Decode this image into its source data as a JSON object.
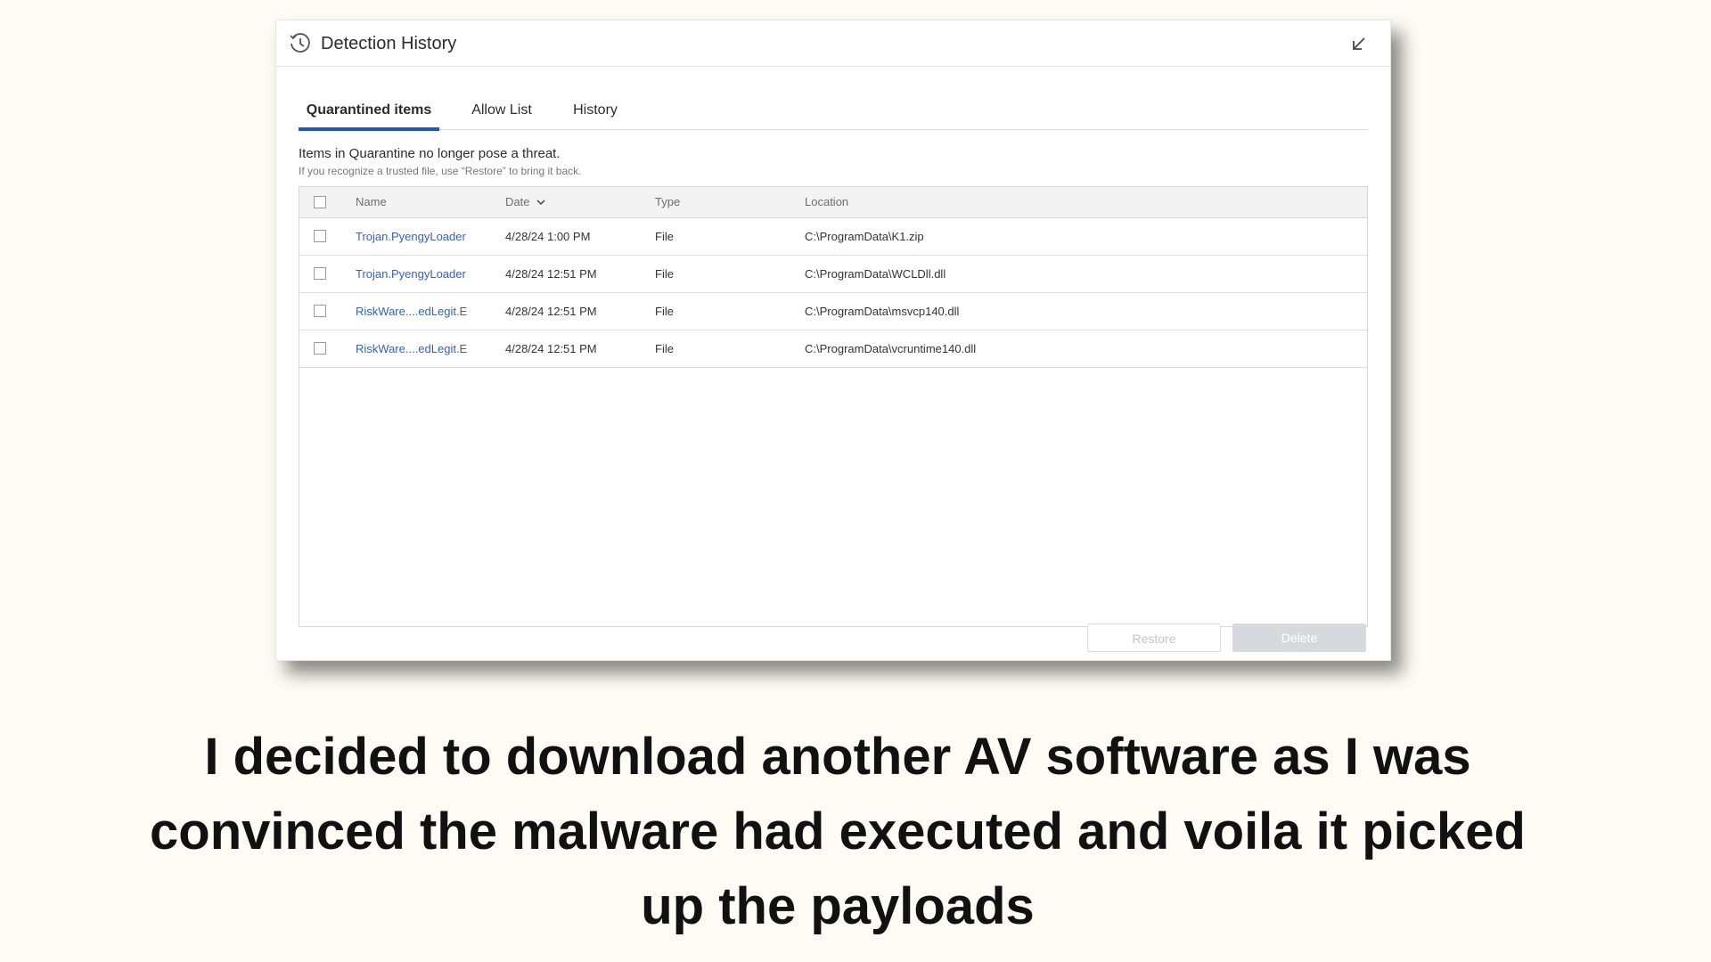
{
  "dialog": {
    "title": "Detection History",
    "title_icon": "clock-history-icon",
    "collapse_icon": "arrow-down-left-icon",
    "tabs": [
      {
        "label": "Quarantined items",
        "active": true
      },
      {
        "label": "Allow List",
        "active": false
      },
      {
        "label": "History",
        "active": false
      }
    ],
    "info": {
      "main": "Items in Quarantine no longer pose a threat.",
      "sub": "If you recognize a trusted file, use “Restore” to bring it back."
    },
    "table": {
      "columns": {
        "name": "Name",
        "date": "Date",
        "type": "Type",
        "location": "Location"
      },
      "rows": [
        {
          "name": "Trojan.PyengyLoader",
          "date": "4/28/24 1:00 PM",
          "type": "File",
          "location": "C:\\ProgramData\\K1.zip"
        },
        {
          "name": "Trojan.PyengyLoader",
          "date": "4/28/24 12:51 PM",
          "type": "File",
          "location": "C:\\ProgramData\\WCLDll.dll"
        },
        {
          "name": "RiskWare....edLegit.E",
          "date": "4/28/24 12:51 PM",
          "type": "File",
          "location": "C:\\ProgramData\\msvcp140.dll"
        },
        {
          "name": "RiskWare....edLegit.E",
          "date": "4/28/24 12:51 PM",
          "type": "File",
          "location": "C:\\ProgramData\\vcruntime140.dll"
        }
      ]
    },
    "buttons": {
      "restore": "Restore",
      "delete": "Delete"
    }
  },
  "caption": {
    "line1": "I decided to download another AV software as I was",
    "line2": "convinced  the malware had executed and voila it picked",
    "line3": "up the payloads"
  },
  "colors": {
    "accent": "#1f57c3",
    "link": "#2e62c9",
    "background": "#fdfbf4"
  }
}
